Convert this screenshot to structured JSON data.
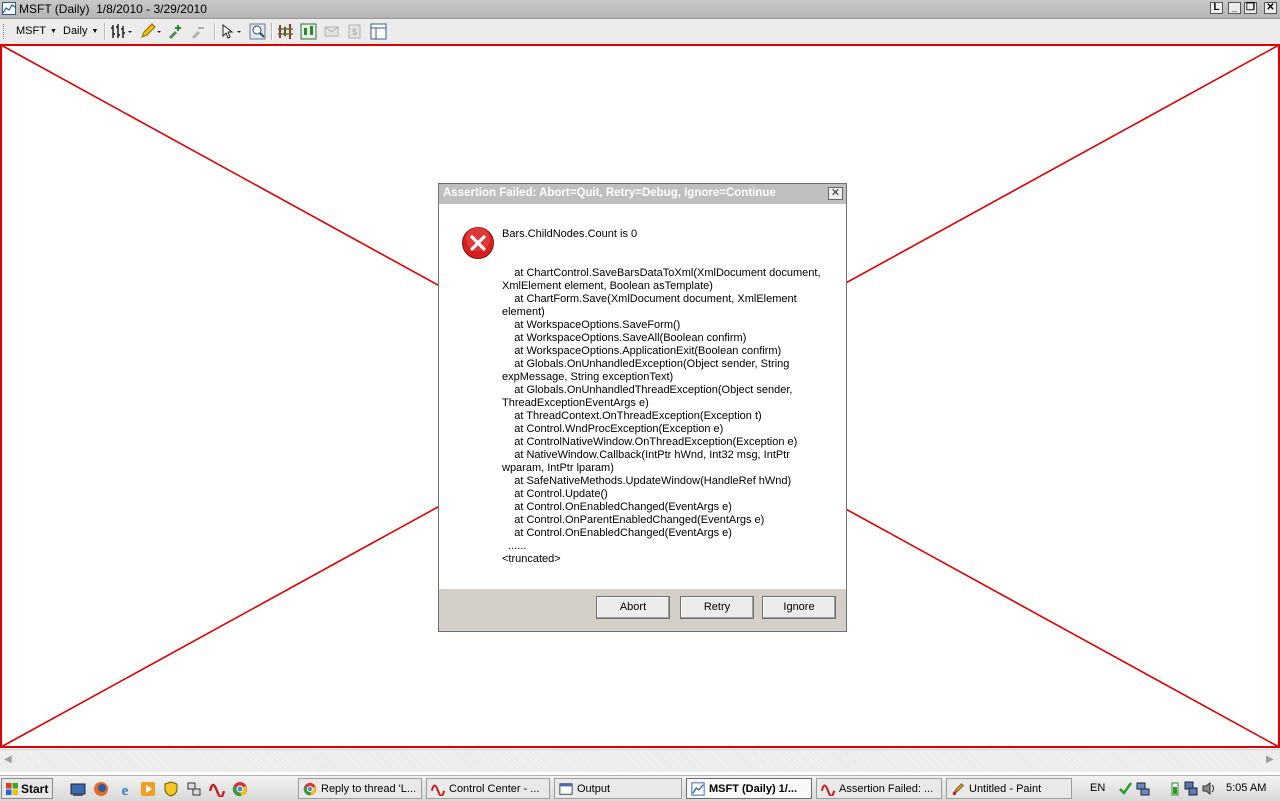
{
  "window": {
    "title": "MSFT (Daily)  1/8/2010 - 3/29/2010",
    "controls": {
      "min": "_",
      "restore": "❐",
      "close": "✕",
      "extra": "L"
    }
  },
  "toolbar": {
    "symbol_label": "MSFT",
    "interval_label": "Daily"
  },
  "dialog": {
    "title": "Assertion Failed: Abort=Quit, Retry=Debug, Ignore=Continue",
    "close": "✕",
    "message": "Bars.ChildNodes.Count is 0",
    "stack": [
      "    at ChartControl.SaveBarsDataToXml(XmlDocument document, XmlElement element, Boolean asTemplate)",
      "    at ChartForm.Save(XmlDocument document, XmlElement element)",
      "    at WorkspaceOptions.SaveForm()",
      "    at WorkspaceOptions.SaveAll(Boolean confirm)",
      "    at WorkspaceOptions.ApplicationExit(Boolean confirm)",
      "    at Globals.OnUnhandledException(Object sender, String expMessage, String exceptionText)",
      "    at Globals.OnUnhandledThreadException(Object sender, ThreadExceptionEventArgs e)",
      "    at ThreadContext.OnThreadException(Exception t)",
      "    at Control.WndProcException(Exception e)",
      "    at ControlNativeWindow.OnThreadException(Exception e)",
      "    at NativeWindow.Callback(IntPtr hWnd, Int32 msg, IntPtr wparam, IntPtr lparam)",
      "    at SafeNativeMethods.UpdateWindow(HandleRef hWnd)",
      "    at Control.Update()",
      "    at Control.OnEnabledChanged(EventArgs e)",
      "    at Control.OnParentEnabledChanged(EventArgs e)",
      "    at Control.OnEnabledChanged(EventArgs e)",
      "  ......",
      "<truncated>"
    ],
    "buttons": {
      "abort": "Abort",
      "retry": "Retry",
      "ignore": "Ignore"
    }
  },
  "taskbar": {
    "start_label": "Start",
    "tasks": [
      {
        "label": "Reply to thread 'L...",
        "icon": "chrome-icon",
        "active": false
      },
      {
        "label": "Control Center - ...",
        "icon": "app-logo-icon",
        "active": false
      },
      {
        "label": "Output",
        "icon": "window-icon",
        "active": false
      },
      {
        "label": "MSFT (Daily)  1/...",
        "icon": "chart-icon",
        "active": true
      },
      {
        "label": "Assertion Failed: ...",
        "icon": "app-logo-icon",
        "active": false
      },
      {
        "label": "Untitled - Paint",
        "icon": "paint-icon",
        "active": false
      }
    ],
    "language": "EN",
    "clock": "5:05 AM"
  },
  "colors": {
    "chart_border": "#e00000",
    "dialog_title_bg": "#bfbfbf",
    "error_icon": "#d42020"
  }
}
